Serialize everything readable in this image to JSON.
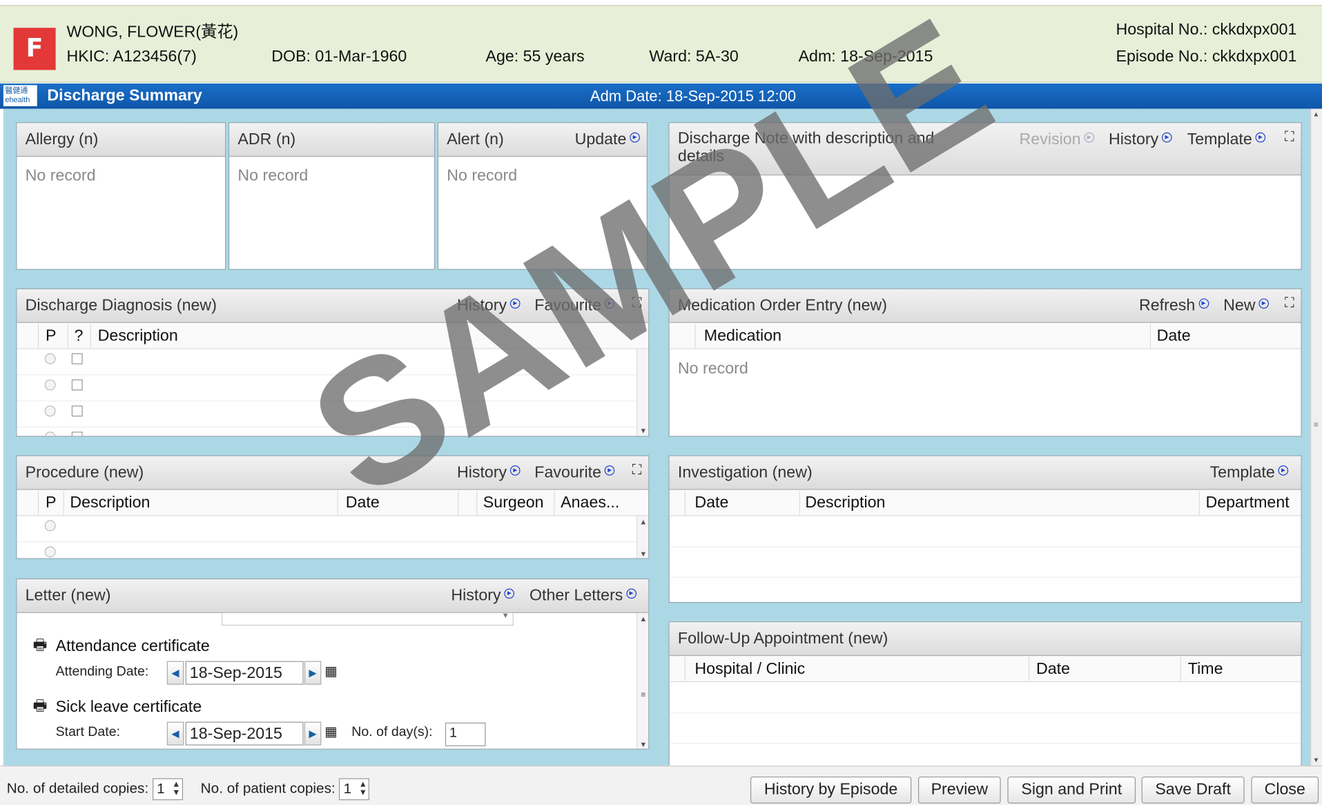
{
  "patient": {
    "sex": "F",
    "name": "WONG, FLOWER(黃花)",
    "hkic": "HKIC: A123456(7)",
    "dob": "DOB: 01-Mar-1960",
    "age": "Age: 55 years",
    "ward": "Ward: 5A-30",
    "adm": "Adm: 18-Sep-2015",
    "hospital_no": "Hospital No.: ckkdxpx001",
    "episode_no": "Episode No.: ckkdxpx001"
  },
  "titlebar": {
    "logo": "醫健通 ehealth",
    "title": "Discharge Summary",
    "adm_date": "Adm Date: 18-Sep-2015 12:00"
  },
  "allergy": {
    "title": "Allergy (n)",
    "empty": "No record"
  },
  "adr": {
    "title": "ADR (n)",
    "empty": "No record"
  },
  "alert": {
    "title": "Alert (n)",
    "update": "Update",
    "empty": "No record"
  },
  "discharge_note": {
    "title_line1": "Discharge Note with description and",
    "title_line2": "details",
    "revision": "Revision",
    "history": "History",
    "template": "Template"
  },
  "diagnosis": {
    "title": "Discharge Diagnosis (new)",
    "history": "History",
    "favourite": "Favourite",
    "columns": [
      "P",
      "?",
      "Description"
    ]
  },
  "medication": {
    "title": "Medication Order Entry (new)",
    "refresh": "Refresh",
    "new": "New",
    "columns": [
      "Medication",
      "Date"
    ],
    "empty": "No record"
  },
  "procedure": {
    "title": "Procedure (new)",
    "history": "History",
    "favourite": "Favourite",
    "columns": [
      "P",
      "Description",
      "Date",
      "Surgeon",
      "Anaes..."
    ]
  },
  "investigation": {
    "title": "Investigation (new)",
    "template": "Template",
    "columns": [
      "Date",
      "Description",
      "Department"
    ]
  },
  "letter": {
    "title": "Letter (new)",
    "history": "History",
    "other_letters": "Other Letters",
    "attendance": "Attendance certificate",
    "attending_date_label": "Attending Date:",
    "attending_date": "18-Sep-2015",
    "sick_leave": "Sick leave certificate",
    "start_date_label": "Start Date:",
    "start_date": "18-Sep-2015",
    "days_label": "No. of day(s):",
    "days": "1"
  },
  "followup": {
    "title": "Follow-Up Appointment (new)",
    "columns": [
      "Hospital / Clinic",
      "Date",
      "Time"
    ]
  },
  "bottom": {
    "detailed_label": "No. of detailed copies:",
    "detailed_value": "1",
    "patient_label": "No. of patient copies:",
    "patient_value": "1",
    "buttons": [
      "History by Episode",
      "Preview",
      "Sign and Print",
      "Save Draft",
      "Close"
    ]
  },
  "watermark": "SAMPLE",
  "colors": {
    "title_bar": "#1a6fc8",
    "patient_bar": "#e8efd8",
    "content_bg": "#acd8e6",
    "sex_badge": "#e23838"
  }
}
